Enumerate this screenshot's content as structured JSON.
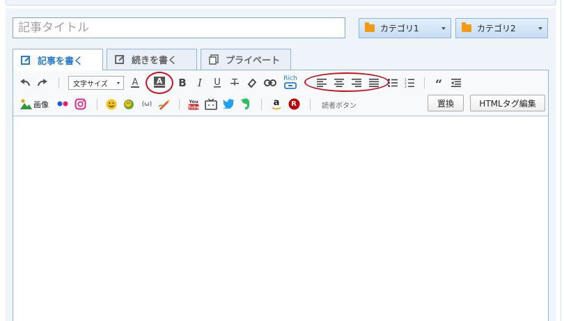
{
  "header": {
    "title_placeholder": "記事タイトル",
    "category1_label": "カテゴリ1",
    "category2_label": "カテゴリ2"
  },
  "tabs": [
    {
      "label": "記事を書く",
      "active": true
    },
    {
      "label": "続きを書く",
      "active": false
    },
    {
      "label": "プライベート",
      "active": false
    }
  ],
  "toolbar": {
    "font_size_label": "文字サイズ",
    "rich_link_label": "Rich",
    "image_label": "画像",
    "reader_button_label": "読者ボタン",
    "replace_label": "置換",
    "html_tag_edit_label": "HTMLタグ編集",
    "kaomoji_label": "(ω)",
    "youtube_label": "You Tube",
    "amazon_label": "a",
    "rakuten_label": "R"
  },
  "colors": {
    "accent": "#2a7cc8",
    "category_icon": "#f59a10",
    "highlight_ellipse": "#d01020",
    "editor_border": "#8fb4d6"
  }
}
